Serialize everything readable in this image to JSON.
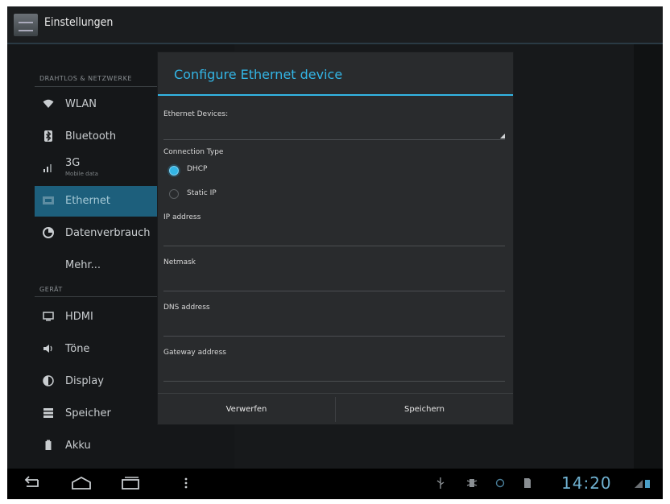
{
  "app": {
    "title": "Einstellungen",
    "icon": "settings-app-icon"
  },
  "sidebar": {
    "section_wireless": "DRAHTLOS & NETZWERKE",
    "section_device": "GERÄT",
    "items": [
      {
        "label": "WLAN",
        "icon": "wifi-icon"
      },
      {
        "label": "Bluetooth",
        "icon": "bluetooth-icon"
      },
      {
        "label": "3G",
        "sublabel": "Mobile data",
        "icon": "signal-icon"
      },
      {
        "label": "Ethernet",
        "icon": "ethernet-icon",
        "selected": true
      },
      {
        "label": "Datenverbrauch",
        "icon": "data-usage-icon"
      },
      {
        "label": "Mehr...",
        "icon": ""
      },
      {
        "label": "HDMI",
        "icon": "monitor-icon"
      },
      {
        "label": "Töne",
        "icon": "speaker-icon"
      },
      {
        "label": "Display",
        "icon": "display-icon"
      },
      {
        "label": "Speicher",
        "icon": "storage-icon"
      },
      {
        "label": "Akku",
        "icon": "battery-icon"
      }
    ]
  },
  "dialog": {
    "title": "Configure Ethernet device",
    "devices_label": "Ethernet Devices:",
    "devices_value": "",
    "connection_type_label": "Connection Type",
    "options": [
      {
        "label": "DHCP",
        "selected": true
      },
      {
        "label": "Static IP",
        "selected": false
      }
    ],
    "ip_label": "IP address",
    "ip_value": "",
    "netmask_label": "Netmask",
    "netmask_value": "",
    "dns_label": "DNS address",
    "dns_value": "",
    "gateway_label": "Gateway address",
    "gateway_value": "",
    "cancel": "Verwerfen",
    "save": "Speichern"
  },
  "navbar": {
    "time": "14:20",
    "back_icon": "back-icon",
    "home_icon": "home-icon",
    "recents_icon": "recents-icon",
    "menu_icon": "menu-icon"
  },
  "colors": {
    "accent": "#33b5e5",
    "selected_bg": "#1d5f7c"
  }
}
